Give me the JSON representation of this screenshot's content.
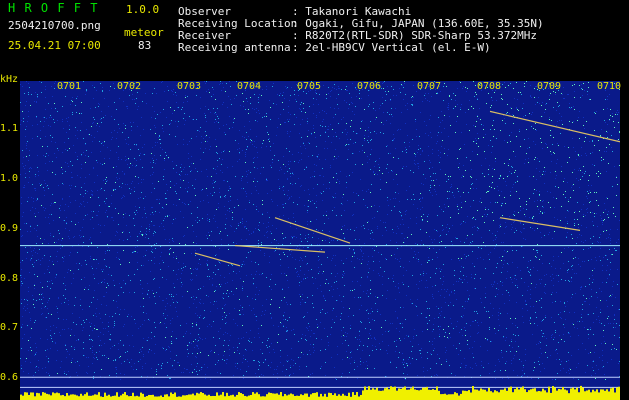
{
  "app": {
    "name_spaced": "H R O F F T",
    "version": "1.0.0",
    "filename": "2504210700.png",
    "mode": "meteor",
    "datetime": "25.04.21 07:00",
    "count": "83"
  },
  "info": {
    "rows": [
      {
        "label": "Observer",
        "value": ": Takanori Kawachi"
      },
      {
        "label": "Receiving Location",
        "value": ": Ogaki, Gifu, JAPAN (136.60E, 35.35N)"
      },
      {
        "label": "Receiver",
        "value": ": R820T2(RTL-SDR) SDR-Sharp 53.372MHz"
      },
      {
        "label": "Receiving antenna",
        "value": ": 2el-HB9CV Vertical (el. E-W)"
      }
    ]
  },
  "spectrogram": {
    "unit": "kHz",
    "y_ticks": [
      "1.1",
      "1.0",
      "0.9",
      "0.8",
      "0.7",
      "0.6"
    ],
    "y_range": [
      0.57,
      1.2
    ],
    "x_ticks": [
      "0701",
      "0702",
      "0703",
      "0704",
      "0705",
      "0706",
      "0707",
      "0708",
      "0709",
      "0710"
    ],
    "colors": {
      "background": "#0a1a8a",
      "noise_low": "#1030c0",
      "noise_high": "#20a0e0",
      "signal": "#60f0c0",
      "echo": "#f0d060",
      "carrier": "#a0f0ff",
      "histogram": "#f0f000"
    }
  }
}
